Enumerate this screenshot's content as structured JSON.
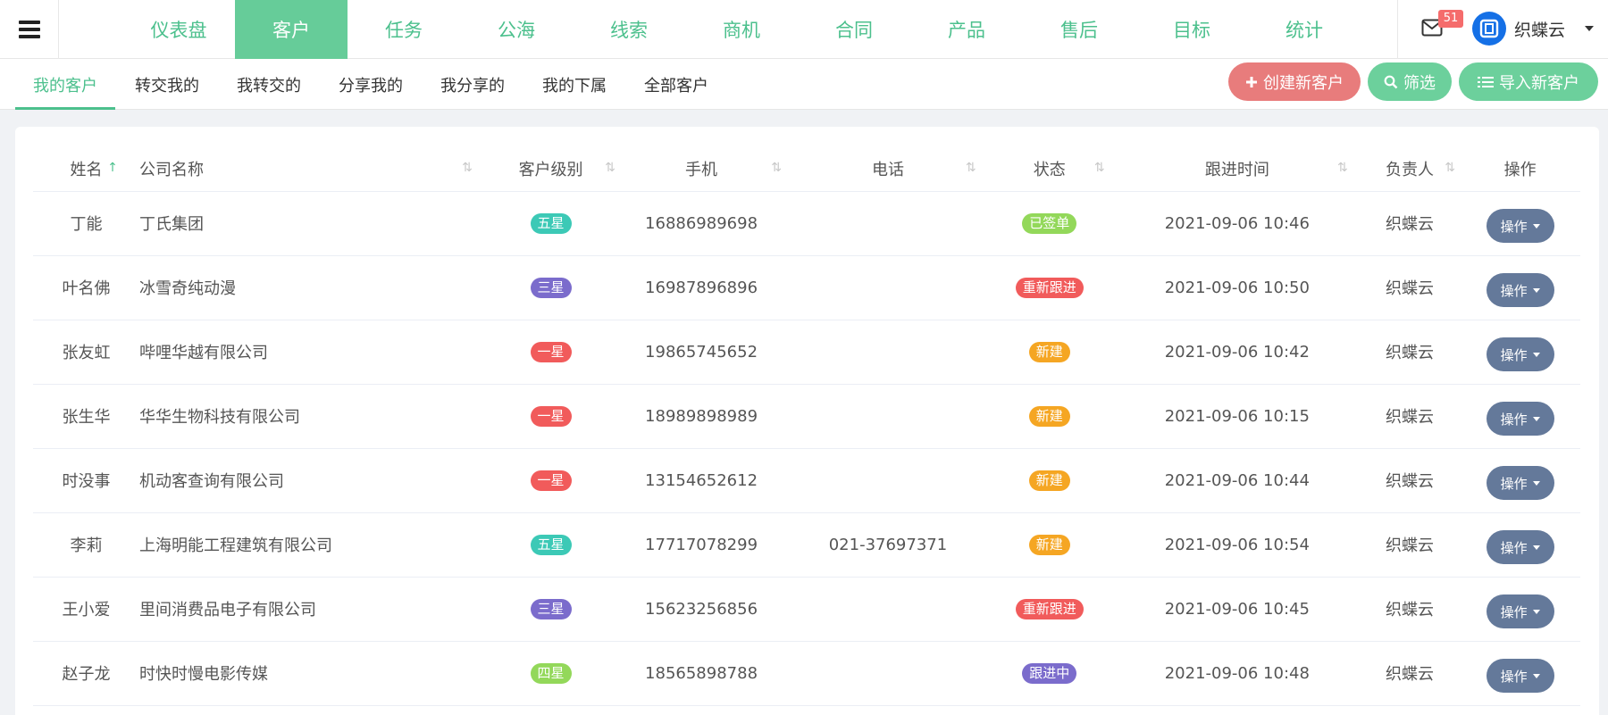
{
  "topnav": {
    "menu": [
      {
        "label": "仪表盘",
        "active": false
      },
      {
        "label": "客户",
        "active": true
      },
      {
        "label": "任务",
        "active": false
      },
      {
        "label": "公海",
        "active": false
      },
      {
        "label": "线索",
        "active": false
      },
      {
        "label": "商机",
        "active": false
      },
      {
        "label": "合同",
        "active": false
      },
      {
        "label": "产品",
        "active": false
      },
      {
        "label": "售后",
        "active": false
      },
      {
        "label": "目标",
        "active": false
      },
      {
        "label": "统计",
        "active": false
      }
    ],
    "mail_count": "51",
    "username": "织蝶云"
  },
  "subnav": {
    "tabs": [
      {
        "label": "我的客户",
        "active": true
      },
      {
        "label": "转交我的",
        "active": false
      },
      {
        "label": "我转交的",
        "active": false
      },
      {
        "label": "分享我的",
        "active": false
      },
      {
        "label": "我分享的",
        "active": false
      },
      {
        "label": "我的下属",
        "active": false
      },
      {
        "label": "全部客户",
        "active": false
      }
    ],
    "create_label": "创建新客户",
    "filter_label": "筛选",
    "import_label": "导入新客户"
  },
  "table": {
    "headers": [
      "姓名",
      "公司名称",
      "客户级别",
      "手机",
      "电话",
      "状态",
      "跟进时间",
      "负责人",
      "操作"
    ],
    "op_label": "操作",
    "rows": [
      {
        "name": "丁能",
        "company": "丁氏集团",
        "level": "五星",
        "level_color": "#3cc9b6",
        "mobile": "16886989698",
        "phone": "",
        "status": "已签单",
        "status_color": "#93d85a",
        "time": "2021-09-06 10:46",
        "owner": "织蝶云"
      },
      {
        "name": "叶名佛",
        "company": "冰雪奇纯动漫",
        "level": "三星",
        "level_color": "#7b6ccc",
        "mobile": "16987896896",
        "phone": "",
        "status": "重新跟进",
        "status_color": "#f15b5b",
        "time": "2021-09-06 10:50",
        "owner": "织蝶云"
      },
      {
        "name": "张友虹",
        "company": "哔哩华越有限公司",
        "level": "一星",
        "level_color": "#f15b5b",
        "mobile": "19865745652",
        "phone": "",
        "status": "新建",
        "status_color": "#f5a623",
        "time": "2021-09-06 10:42",
        "owner": "织蝶云"
      },
      {
        "name": "张生华",
        "company": "华华生物科技有限公司",
        "level": "一星",
        "level_color": "#f15b5b",
        "mobile": "18989898989",
        "phone": "",
        "status": "新建",
        "status_color": "#f5a623",
        "time": "2021-09-06 10:15",
        "owner": "织蝶云"
      },
      {
        "name": "时没事",
        "company": "机动客查询有限公司",
        "level": "一星",
        "level_color": "#f15b5b",
        "mobile": "13154652612",
        "phone": "",
        "status": "新建",
        "status_color": "#f5a623",
        "time": "2021-09-06 10:44",
        "owner": "织蝶云"
      },
      {
        "name": "李莉",
        "company": "上海明能工程建筑有限公司",
        "level": "五星",
        "level_color": "#3cc9b6",
        "mobile": "17717078299",
        "phone": "021-37697371",
        "status": "新建",
        "status_color": "#f5a623",
        "time": "2021-09-06 10:54",
        "owner": "织蝶云"
      },
      {
        "name": "王小爱",
        "company": "里间消费品电子有限公司",
        "level": "三星",
        "level_color": "#7b6ccc",
        "mobile": "15623256856",
        "phone": "",
        "status": "重新跟进",
        "status_color": "#f15b5b",
        "time": "2021-09-06 10:45",
        "owner": "织蝶云"
      },
      {
        "name": "赵子龙",
        "company": "时快时慢电影传媒",
        "level": "四星",
        "level_color": "#93d85a",
        "mobile": "18565898788",
        "phone": "",
        "status": "跟进中",
        "status_color": "#7b6ccc",
        "time": "2021-09-06 10:48",
        "owner": "织蝶云"
      }
    ]
  }
}
